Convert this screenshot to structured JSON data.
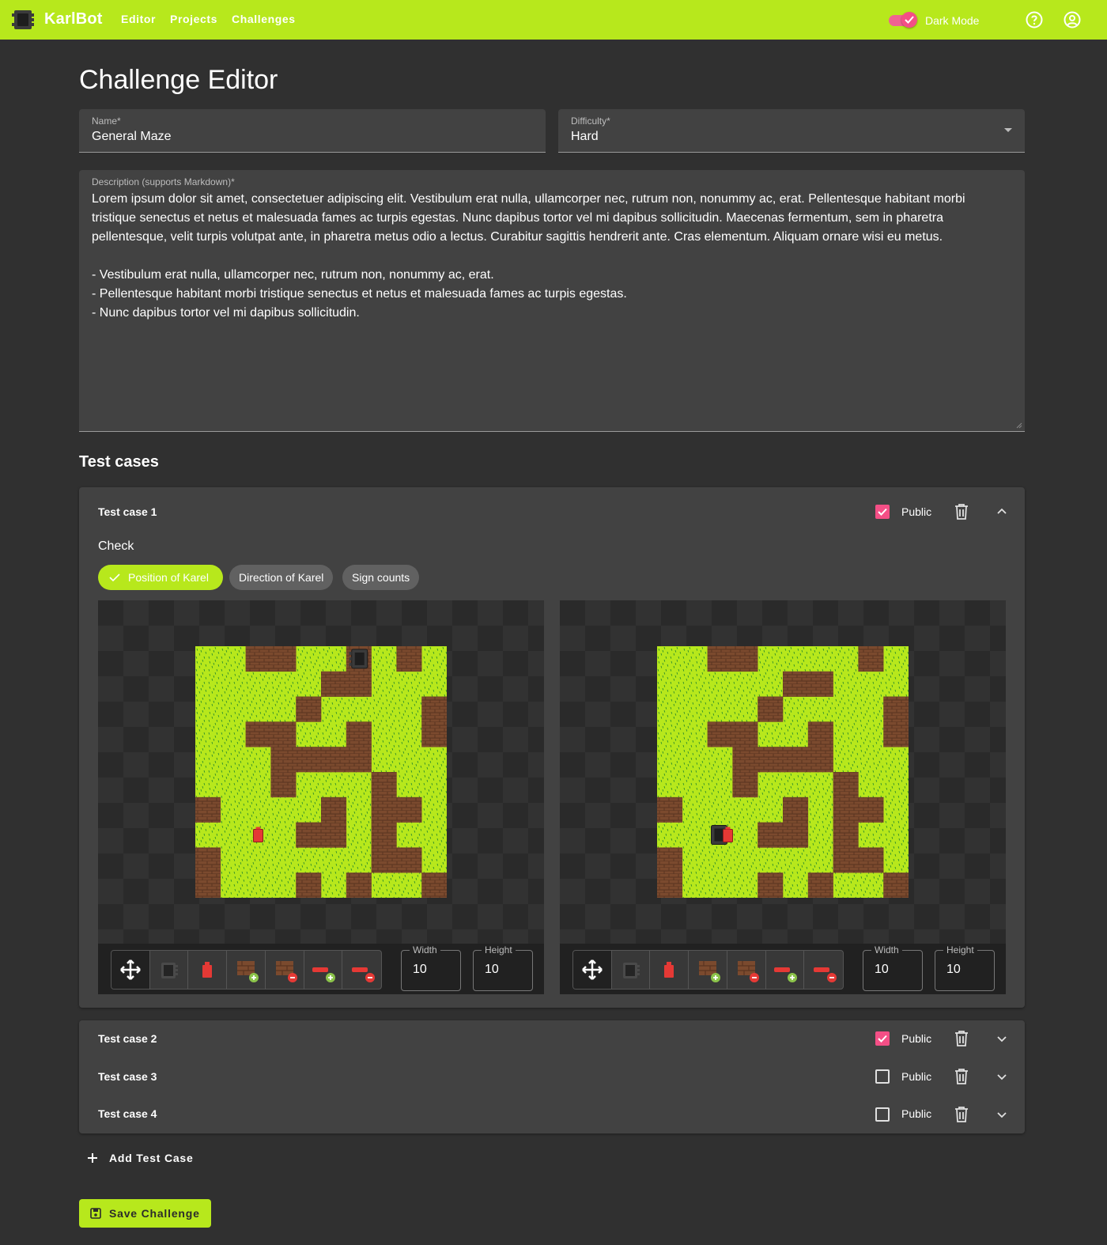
{
  "appbar": {
    "brand": "KarlBot",
    "nav": [
      "Editor",
      "Projects",
      "Challenges"
    ],
    "dark_mode_label": "Dark Mode",
    "dark_mode_on": true,
    "accent": "#b7e81c"
  },
  "page": {
    "title": "Challenge Editor",
    "name_label": "Name*",
    "name_value": "General Maze",
    "difficulty_label": "Difficulty*",
    "difficulty_value": "Hard",
    "description_label": "Description (supports Markdown)*",
    "description_value": "Lorem ipsum dolor sit amet, consectetuer adipiscing elit. Vestibulum erat nulla, ullamcorper nec, rutrum non, nonummy ac, erat. Pellentesque habitant morbi tristique senectus et netus et malesuada fames ac turpis egestas. Nunc dapibus tortor vel mi dapibus sollicitudin. Maecenas fermentum, sem in pharetra pellentesque, velit turpis volutpat ante, in pharetra metus odio a lectus. Curabitur sagittis hendrerit ante. Cras elementum. Aliquam ornare wisi eu metus.\n\n- Vestibulum erat nulla, ullamcorper nec, rutrum non, nonummy ac, erat.\n- Pellentesque habitant morbi tristique senectus et netus et malesuada fames ac turpis egestas.\n- Nunc dapibus tortor vel mi dapibus sollicitudin."
  },
  "test_cases_title": "Test cases",
  "test_cases": [
    {
      "title": "Test case 1",
      "public": true,
      "expanded": true
    },
    {
      "title": "Test case 2",
      "public": true,
      "expanded": false
    },
    {
      "title": "Test case 3",
      "public": false,
      "expanded": false
    },
    {
      "title": "Test case 4",
      "public": false,
      "expanded": false
    }
  ],
  "public_label": "Public",
  "expanded": {
    "check_label": "Check",
    "chips": [
      {
        "label": "Position of Karel",
        "selected": true
      },
      {
        "label": "Direction of Karel",
        "selected": false
      },
      {
        "label": "Sign counts",
        "selected": false
      }
    ],
    "tools": [
      "move-icon",
      "karel-icon",
      "sign-icon",
      "add-wall-icon",
      "remove-wall-icon",
      "add-sign-icon",
      "remove-sign-icon"
    ],
    "width_label": "Width",
    "width_value": "10",
    "height_label": "Height",
    "height_value": "10",
    "pre_world": {
      "walls": [
        "..xx..x.x.",
        ".....xx...",
        "....x....x",
        "..xx..x..x",
        "...xxxx...",
        "...x...x..",
        "x....x.xx.",
        "....xx.x..",
        "x......xx.",
        "x...x.x..x"
      ],
      "karel": [
        6,
        0,
        "west"
      ],
      "sign": [
        2,
        7
      ]
    },
    "post_world": {
      "walls": [
        "..xx....x.",
        ".....xx...",
        "....x....x",
        "..xx..x..x",
        "...xxxx...",
        "...x...x..",
        "x....x.xx.",
        "....xx.x..",
        "x......xx.",
        "x...x.x..x"
      ],
      "karel": [
        2,
        7,
        "east"
      ],
      "sign": [
        2,
        7
      ]
    }
  },
  "add_test_case_label": "Add Test Case",
  "save_label": "Save Challenge"
}
